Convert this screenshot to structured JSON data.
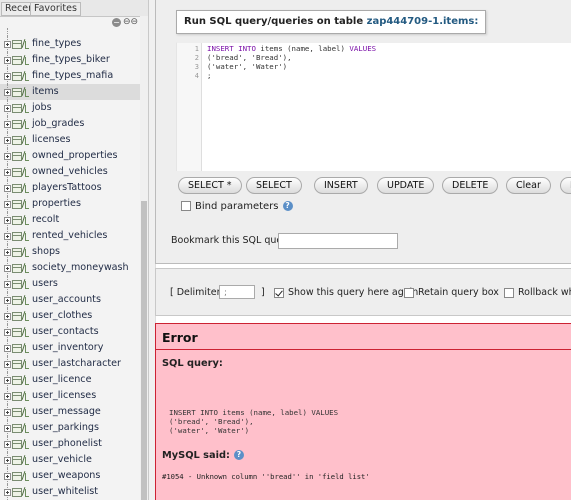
{
  "sidebar": {
    "tabs": {
      "recent": "Recent",
      "favorites": "Favorites"
    },
    "collapse_icon": "collapse-all-icon",
    "link_icon": "link-with-main-icon",
    "tables": [
      "fine_types",
      "fine_types_biker",
      "fine_types_mafia",
      "items",
      "jobs",
      "job_grades",
      "licenses",
      "owned_properties",
      "owned_vehicles",
      "playersTattoos",
      "properties",
      "recolt",
      "rented_vehicles",
      "shops",
      "society_moneywash",
      "users",
      "user_accounts",
      "user_clothes",
      "user_contacts",
      "user_inventory",
      "user_lastcharacter",
      "user_licence",
      "user_licenses",
      "user_message",
      "user_parkings",
      "user_phonelist",
      "user_vehicle",
      "user_weapons",
      "user_whitelist"
    ],
    "selected_table": "items"
  },
  "query_panel": {
    "legend_prefix": "Run SQL query/queries on table ",
    "legend_table": "zap444709-1.items:",
    "line_numbers": [
      "1",
      "2",
      "3",
      "4"
    ],
    "code": {
      "l1_kw": "INSERT INTO",
      "l1_rest": " items (name, label) ",
      "l1_kw2": "VALUES",
      "l2": "('bread', 'Bread'),",
      "l3": "('water', 'Water')",
      "l4": ";"
    },
    "buttons": {
      "select_star": "SELECT *",
      "select": "SELECT",
      "insert": "INSERT",
      "update": "UPDATE",
      "delete": "DELETE",
      "clear": "Clear",
      "format": "F"
    },
    "bind_parameters": "Bind parameters",
    "bookmark_label": "Bookmark this SQL query:"
  },
  "options": {
    "delimiter_label": "[ Delimiter",
    "delimiter_value": ";",
    "delimiter_close": "]",
    "show_query": "Show this query here again",
    "show_query_checked": true,
    "retain": "Retain query box",
    "rollback": "Rollback when fin"
  },
  "error": {
    "title": "Error",
    "sql_query_label": "SQL query:",
    "query_lines": [
      "INSERT INTO items (name, label) VALUES",
      "('bread', 'Bread'),",
      "('water', 'Water')"
    ],
    "mysql_said": "MySQL said:",
    "message": "#1054 - Unknown column ''bread'' in 'field list'"
  },
  "colors": {
    "error_bg": "#ffc0cb",
    "error_border": "#cc2233",
    "link": "#235a81",
    "keyword": "#7a0fa8"
  }
}
